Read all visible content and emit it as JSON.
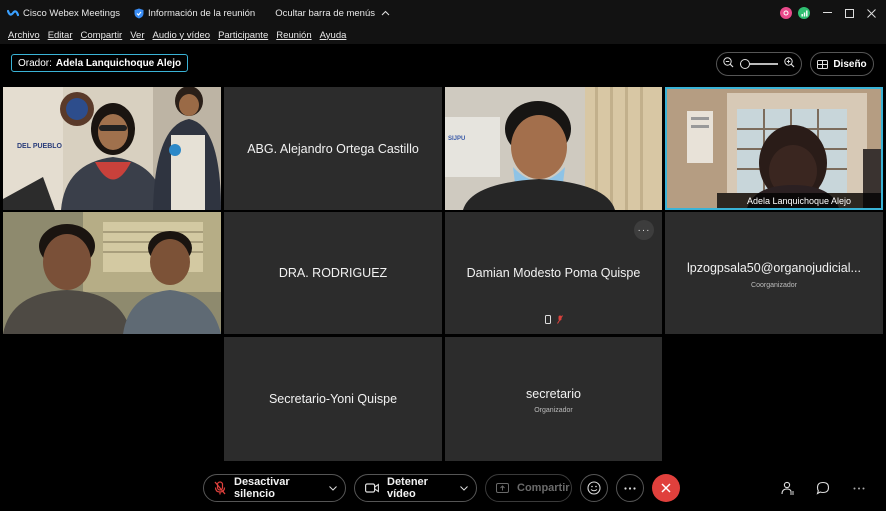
{
  "titlebar": {
    "app_name": "Cisco Webex Meetings",
    "meeting_info": "Información de la reunión",
    "hide_menu": "Ocultar barra de menús"
  },
  "menu": {
    "items": [
      "Archivo",
      "Editar",
      "Compartir",
      "Ver",
      "Audio y vídeo",
      "Participante",
      "Reunión",
      "Ayuda"
    ]
  },
  "header": {
    "speaker_label": "Orador:",
    "speaker_name": "Adela Lanquichoque Alejo",
    "layout_label": "Diseño"
  },
  "tiles": {
    "alejandro": "ABG. Alejandro Ortega Castillo",
    "adela": "Adela Lanquichoque Alejo",
    "rodriguez": "DRA. RODRIGUEZ",
    "damian": "Damian Modesto Poma Quispe",
    "lpz": "lpzogpsala50@organojudicial...",
    "lpz_role": "Coorganizador",
    "yoni": "Secretario-Yoni Quispe",
    "secretario": "secretario",
    "secretario_role": "Organizador",
    "sijpu_sign": "SIJPU",
    "pueblo_sign": "DEL PUEBLO"
  },
  "controls": {
    "mute_label": "Desactivar silencio",
    "video_label": "Detener vídeo",
    "share_label": "Compartir"
  },
  "colors": {
    "accent": "#3ab3d6",
    "end_call": "#e0403c",
    "tile_bg": "#2c2c2c"
  }
}
